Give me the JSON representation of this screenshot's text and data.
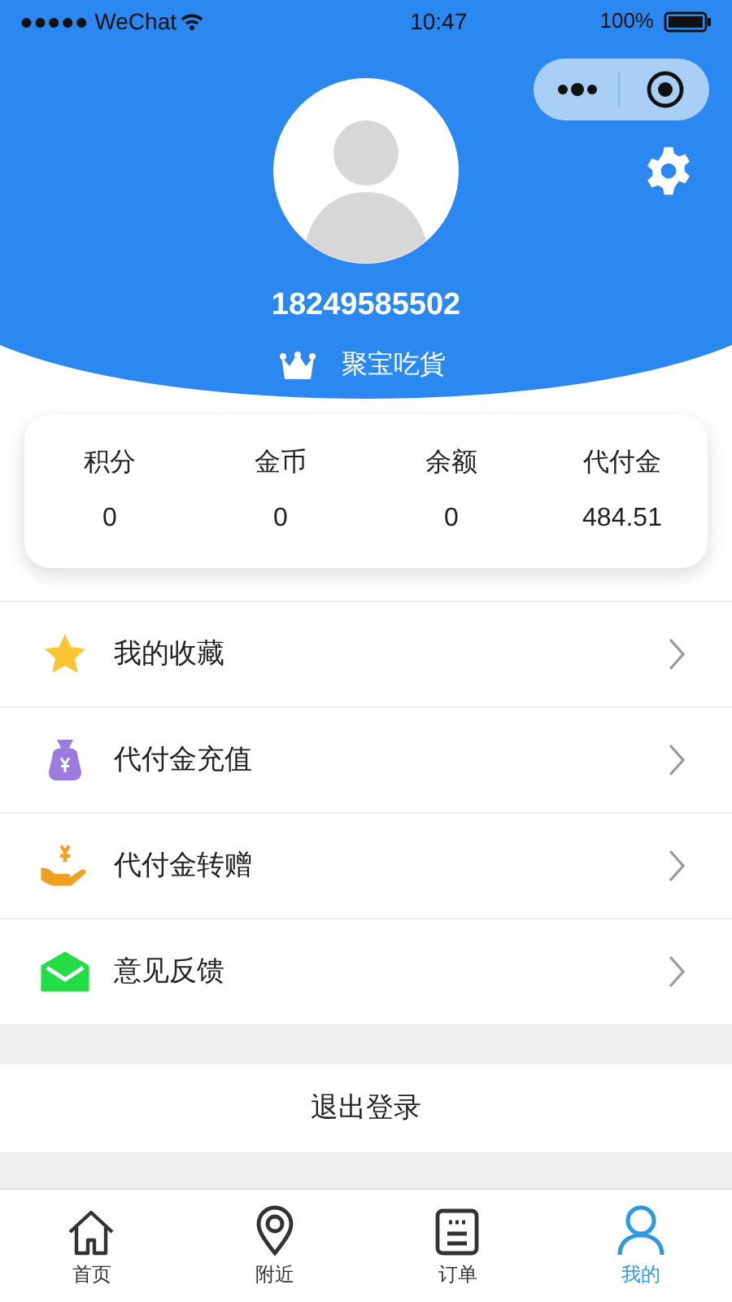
{
  "status_bar": {
    "carrier": "●●●●● WeChat",
    "time": "10:47",
    "battery": "100%"
  },
  "profile": {
    "phone": "18249585502",
    "level": "聚宝吃貨"
  },
  "stats": [
    {
      "label": "积分",
      "value": "0"
    },
    {
      "label": "金币",
      "value": "0"
    },
    {
      "label": "余额",
      "value": "0"
    },
    {
      "label": "代付金",
      "value": "484.51"
    }
  ],
  "menu": [
    {
      "kind": "star",
      "label": "我的收藏"
    },
    {
      "kind": "moneybag",
      "label": "代付金充值"
    },
    {
      "kind": "gift",
      "label": "代付金转赠"
    },
    {
      "kind": "mail",
      "label": "意见反馈"
    }
  ],
  "logout": "退出登录",
  "tab_bar": [
    {
      "kind": "home",
      "label": "首页",
      "selected": false
    },
    {
      "kind": "pin",
      "label": "附近",
      "selected": false
    },
    {
      "kind": "order",
      "label": "订单",
      "selected": false
    },
    {
      "kind": "user",
      "label": "我的",
      "selected": true
    }
  ]
}
